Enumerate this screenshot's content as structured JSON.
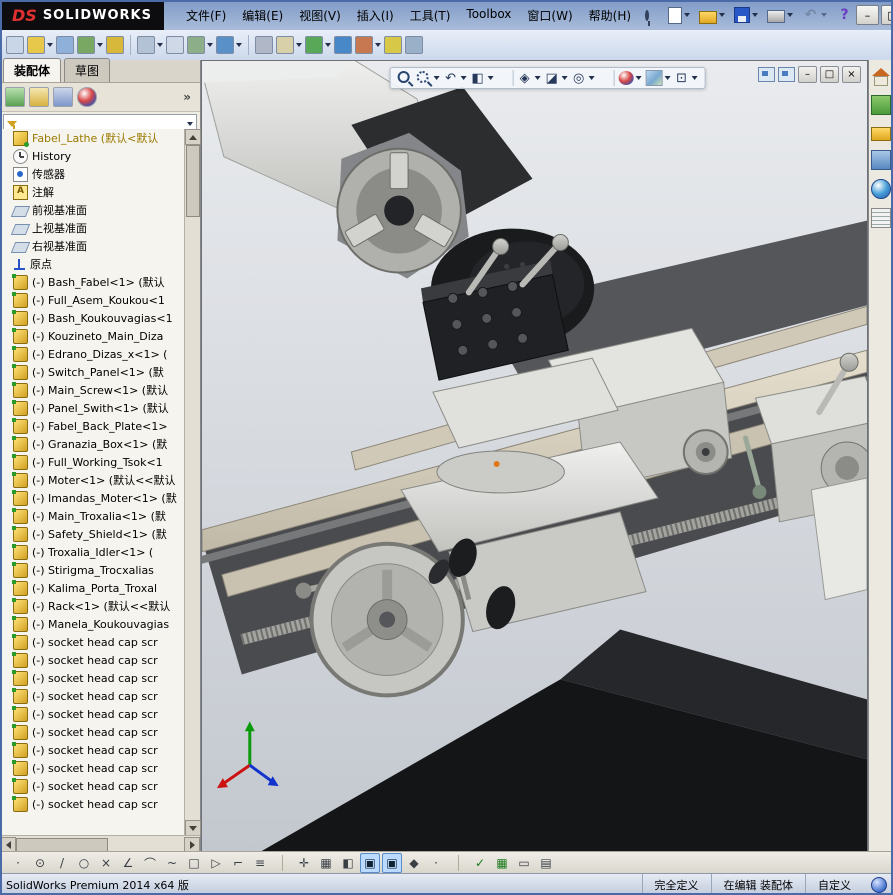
{
  "titlebar": {
    "logo_ds": "DS",
    "logo_text": "SOLIDWORKS",
    "menus": [
      {
        "label": "文件(F)"
      },
      {
        "label": "编辑(E)"
      },
      {
        "label": "视图(V)"
      },
      {
        "label": "插入(I)"
      },
      {
        "label": "工具(T)"
      },
      {
        "label": "Toolbox"
      },
      {
        "label": "窗口(W)"
      },
      {
        "label": "帮助(H)"
      }
    ],
    "quick_icons": [
      {
        "name": "new",
        "caret": true
      },
      {
        "name": "open",
        "caret": true
      },
      {
        "name": "save",
        "caret": true
      },
      {
        "name": "print",
        "caret": true
      },
      {
        "name": "undo",
        "glyph": "↶",
        "caret": true,
        "state": "disabled"
      },
      {
        "name": "help",
        "glyph": "?"
      }
    ],
    "window_controls": {
      "minimize": "–",
      "maximize": "□",
      "close": "×"
    }
  },
  "toolbar2": {
    "icons": [
      {
        "name": "edit-component",
        "color": "#c9d6e8"
      },
      {
        "name": "insert-components",
        "color": "#e8c84a",
        "caret": true
      },
      {
        "name": "mate",
        "color": "#8fb0d8"
      },
      {
        "name": "linear-component-pattern",
        "color": "#79a862",
        "caret": true
      },
      {
        "name": "smart-fasteners",
        "color": "#d8b83a"
      },
      {
        "kind": "sep"
      },
      {
        "name": "move-component",
        "color": "#b4c2d6",
        "caret": true
      },
      {
        "name": "show-hidden-components",
        "color": "#cfd8e6"
      },
      {
        "name": "assembly-features",
        "color": "#8cae88",
        "caret": true
      },
      {
        "name": "reference-geometry",
        "color": "#5a90c8",
        "caret": true
      },
      {
        "kind": "sep"
      },
      {
        "name": "new-motion-study",
        "color": "#b0b8c8"
      },
      {
        "name": "bill-of-materials",
        "color": "#d8d0a8",
        "caret": true
      },
      {
        "name": "exploded-view",
        "color": "#58a858",
        "caret": true
      },
      {
        "name": "explode-line-sketch",
        "color": "#4888c8"
      },
      {
        "name": "interference-detection",
        "color": "#c87850",
        "caret": true
      },
      {
        "name": "measure",
        "color": "#d8c848"
      },
      {
        "name": "mass-properties",
        "color": "#9ab0c8"
      }
    ]
  },
  "panel": {
    "tabs": [
      {
        "label": "装配体",
        "state": "active"
      },
      {
        "label": "草图",
        "state": ""
      }
    ],
    "more_label": "»",
    "header_icons": [
      {
        "name": "featuremanager-tree"
      },
      {
        "name": "propertymanager"
      },
      {
        "name": "configuration-manager"
      },
      {
        "name": "appearances-manager"
      }
    ],
    "tree": [
      {
        "icon": "root",
        "cls": "root",
        "label": "Fabel_Lathe (默认<默认"
      },
      {
        "icon": "history",
        "label": "History"
      },
      {
        "icon": "sensors",
        "label": "传感器"
      },
      {
        "icon": "annotations",
        "label": "注解"
      },
      {
        "icon": "plane",
        "label": "前视基准面"
      },
      {
        "icon": "plane",
        "label": "上视基准面"
      },
      {
        "icon": "plane",
        "label": "右视基准面"
      },
      {
        "icon": "origin",
        "label": "原点"
      },
      {
        "icon": "comp",
        "label": "(-) Bash_Fabel<1> (默认"
      },
      {
        "icon": "comp",
        "label": "(-) Full_Asem_Koukou<1"
      },
      {
        "icon": "comp",
        "label": "(-) Bash_Koukouvagias<1"
      },
      {
        "icon": "comp",
        "label": "(-) Kouzineto_Main_Diza"
      },
      {
        "icon": "comp",
        "label": "(-) Edrano_Dizas_x<1> ("
      },
      {
        "icon": "comp",
        "label": "(-) Switch_Panel<1> (默"
      },
      {
        "icon": "comp",
        "label": "(-) Main_Screw<1> (默认"
      },
      {
        "icon": "comp",
        "label": "(-) Panel_Swith<1> (默认"
      },
      {
        "icon": "comp",
        "label": "(-) Fabel_Back_Plate<1>"
      },
      {
        "icon": "comp",
        "label": "(-) Granazia_Box<1> (默"
      },
      {
        "icon": "comp",
        "label": "(-) Full_Working_Tsok<1"
      },
      {
        "icon": "comp",
        "label": "(-) Moter<1> (默认<<默认"
      },
      {
        "icon": "comp",
        "label": "(-) Imandas_Moter<1> (默"
      },
      {
        "icon": "comp",
        "label": "(-) Main_Troxalia<1> (默"
      },
      {
        "icon": "comp",
        "label": "(-) Safety_Shield<1> (默"
      },
      {
        "icon": "comp",
        "label": "(-) Troxalia_Idler<1> ("
      },
      {
        "icon": "comp",
        "label": "(-) Stirigma_Trocxalias"
      },
      {
        "icon": "comp",
        "label": "(-) Kalima_Porta_Troxal"
      },
      {
        "icon": "comp",
        "label": "(-) Rack<1> (默认<<默认"
      },
      {
        "icon": "comp",
        "label": "(-) Manela_Koukouvagias"
      },
      {
        "icon": "comp",
        "label": "(-) socket head cap scr"
      },
      {
        "icon": "comp",
        "label": "(-) socket head cap scr"
      },
      {
        "icon": "comp",
        "label": "(-) socket head cap scr"
      },
      {
        "icon": "comp",
        "label": "(-) socket head cap scr"
      },
      {
        "icon": "comp",
        "label": "(-) socket head cap scr"
      },
      {
        "icon": "comp",
        "label": "(-) socket head cap scr"
      },
      {
        "icon": "comp",
        "label": "(-) socket head cap scr"
      },
      {
        "icon": "comp",
        "label": "(-) socket head cap scr"
      },
      {
        "icon": "comp",
        "label": "(-) socket head cap scr"
      },
      {
        "icon": "comp",
        "label": "(-) socket head cap scr"
      }
    ]
  },
  "viewport": {
    "headsup": [
      {
        "name": "zoom-fit"
      },
      {
        "name": "zoom-area",
        "caret": true
      },
      {
        "name": "previous-view",
        "glyph": "↶",
        "caret": true
      },
      {
        "name": "section-view",
        "glyph": "◧",
        "caret": true
      },
      {
        "kind": "sep"
      },
      {
        "name": "view-orientation",
        "glyph": "◈",
        "caret": true
      },
      {
        "name": "display-style",
        "glyph": "◪",
        "caret": true
      },
      {
        "name": "hide-show-items",
        "glyph": "◎",
        "caret": true
      },
      {
        "kind": "sep"
      },
      {
        "name": "edit-appearance",
        "caret": true
      },
      {
        "name": "apply-scene",
        "caret": true
      },
      {
        "name": "view-settings",
        "glyph": "⊡",
        "caret": true
      }
    ],
    "doc_buttons": [
      {
        "name": "featuremanager-pane-toggle"
      },
      {
        "name": "display-pane-toggle"
      }
    ],
    "window_controls": {
      "minimize": "–",
      "restore": "□",
      "close": "×"
    }
  },
  "taskpane": {
    "icons": [
      {
        "name": "home"
      },
      {
        "name": "design-library"
      },
      {
        "name": "file-explorer"
      },
      {
        "name": "view-palette"
      },
      {
        "name": "appearances"
      },
      {
        "name": "custom-properties"
      }
    ]
  },
  "bottombar": {
    "icons": [
      {
        "name": "point",
        "glyph": "·"
      },
      {
        "name": "circle",
        "glyph": "⊙"
      },
      {
        "name": "line",
        "glyph": "/"
      },
      {
        "name": "ellipse",
        "glyph": "○"
      },
      {
        "name": "trim",
        "glyph": "×"
      },
      {
        "name": "angle",
        "glyph": "∠"
      },
      {
        "name": "arc",
        "glyph": "⌒"
      },
      {
        "name": "spline",
        "glyph": "~"
      },
      {
        "name": "rectangle",
        "glyph": "□"
      },
      {
        "name": "mirror",
        "glyph": "▷"
      },
      {
        "name": "corner",
        "glyph": "⌐"
      },
      {
        "name": "linear-pattern",
        "glyph": "≡"
      },
      {
        "kind": "sep"
      },
      {
        "name": "pan",
        "glyph": "✛"
      },
      {
        "name": "grid",
        "glyph": "▦"
      },
      {
        "name": "section",
        "glyph": "◧"
      },
      {
        "name": "shaded-with-edges",
        "glyph": "▣",
        "state": "active"
      },
      {
        "name": "shaded",
        "glyph": "▣",
        "state": "active"
      },
      {
        "name": "view-cube",
        "glyph": "◆"
      },
      {
        "name": "origin-dot",
        "glyph": "·"
      },
      {
        "kind": "sep"
      },
      {
        "name": "design-check",
        "glyph": "✓",
        "state": "green"
      },
      {
        "name": "feature-display",
        "glyph": "▦",
        "state": "green"
      },
      {
        "name": "window-view",
        "glyph": "▭"
      },
      {
        "name": "sheet",
        "glyph": "▤"
      }
    ]
  },
  "statusbar": {
    "left": "SolidWorks Premium 2014 x64 版",
    "cells": [
      {
        "label": "完全定义"
      },
      {
        "label": "在编辑 装配体"
      },
      {
        "label": "自定义"
      }
    ]
  }
}
